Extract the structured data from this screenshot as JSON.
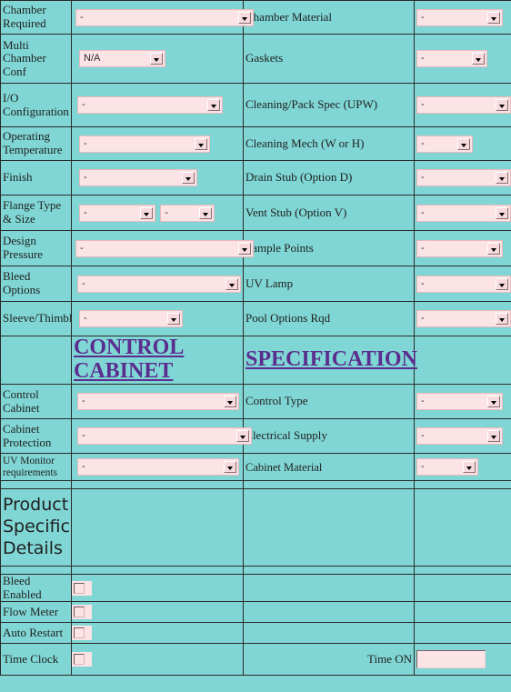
{
  "colors": {
    "page_background": "#7fd6d4",
    "field_background": "#fce4e6",
    "heading_text": "#5b2d8e",
    "border": "#2b2b2b",
    "label_text": "#222222"
  },
  "chamber_section": {
    "rows": [
      {
        "left_label": "Chamber Required",
        "left_control": {
          "type": "select",
          "value": "-",
          "size": "xxl",
          "overflow": true
        },
        "right_label": "Chamber Material",
        "right_control": {
          "type": "select",
          "value": "-",
          "size": "xs"
        }
      },
      {
        "left_label": "Multi Chamber Conf",
        "left_control": {
          "type": "select",
          "value": "N/A",
          "size": "h2_wide",
          "overflow": false
        },
        "right_label": "Gaskets",
        "right_control": {
          "type": "select",
          "value": "-",
          "size": "tiny"
        }
      },
      {
        "left_label": "I/O Configuration",
        "left_control": {
          "type": "select",
          "value": "-",
          "size": "lg",
          "overflow": false
        },
        "right_label": "Cleaning/Pack  Spec (UPW)",
        "right_control": {
          "type": "select",
          "value": "-",
          "size": "xs_wide"
        }
      },
      {
        "left_label": "Operating Temperature",
        "left_control": {
          "type": "select",
          "value": "-",
          "size": "md",
          "overflow": false
        },
        "right_label": "Cleaning Mech  (W or H)",
        "right_control": {
          "type": "select",
          "value": "-",
          "size": "half"
        }
      },
      {
        "left_label": "Finish",
        "left_control": {
          "type": "select",
          "value": "-",
          "size": "sm",
          "overflow": false
        },
        "right_label": "Drain Stub  (Option D)",
        "right_control": {
          "type": "select",
          "value": "-",
          "size": "xs_wide"
        }
      },
      {
        "left_label": "Flange Type & Size",
        "left_control": {
          "type": "select-pair",
          "value_a": "-",
          "value_b": "-"
        },
        "right_label": "Vent Stub (Option V)",
        "right_control": {
          "type": "select",
          "value": "-",
          "size": "xs_wide"
        }
      },
      {
        "left_label": "Design Pressure",
        "left_control": {
          "type": "select",
          "value": "-",
          "size": "xxl",
          "overflow": true
        },
        "right_label": "Sample Points",
        "right_control": {
          "type": "select",
          "value": "-",
          "size": "xs"
        }
      },
      {
        "left_label": "Bleed Options",
        "left_control": {
          "type": "select",
          "value": "-",
          "size": "xl",
          "overflow": true
        },
        "right_label": "UV Lamp",
        "right_control": {
          "type": "select",
          "value": "-",
          "size": "xs_wide"
        }
      },
      {
        "left_label": "Sleeve/Thimble",
        "left_control": {
          "type": "select",
          "value": "-",
          "size": "sm",
          "overflow": false
        },
        "right_label": "Pool Options Rqd",
        "right_control": {
          "type": "select",
          "value": "-",
          "size": "xs_wide"
        }
      }
    ]
  },
  "section_headings": {
    "left": "CONTROL CABINET",
    "right": "SPECIFICATION"
  },
  "cabinet_section": {
    "rows": [
      {
        "left_label": "Control Cabinet",
        "left_control": {
          "type": "select",
          "value": "-",
          "size": "xl",
          "overflow": true
        },
        "right_label": "Control Type",
        "right_control": {
          "type": "select",
          "value": "-",
          "size": "xs"
        }
      },
      {
        "left_label": "Cabinet Protection",
        "left_control": {
          "type": "select",
          "value": "-",
          "size": "xl",
          "overflow": true
        },
        "right_label": "Electrical Supply",
        "right_control": {
          "type": "select",
          "value": "-",
          "size": "xs"
        }
      },
      {
        "left_label": "UV Monitor requirements",
        "left_control": {
          "type": "select",
          "value": "-",
          "size": "xl",
          "overflow": true
        },
        "right_label": "Cabinet Material",
        "right_control": {
          "type": "select",
          "value": "-",
          "size": "half_wide"
        }
      }
    ]
  },
  "product_specific": {
    "title": "Product Specific Details"
  },
  "options_section": {
    "rows": [
      {
        "label": "Bleed Enabled",
        "control": "checkbox",
        "checked": false
      },
      {
        "label": "Flow Meter",
        "control": "checkbox",
        "checked": false
      },
      {
        "label": "Auto Restart",
        "control": "checkbox",
        "checked": false
      },
      {
        "label": "Time Clock",
        "control": "checkbox",
        "checked": false
      }
    ],
    "time_on_label": "Time ON",
    "time_on_value": ""
  }
}
